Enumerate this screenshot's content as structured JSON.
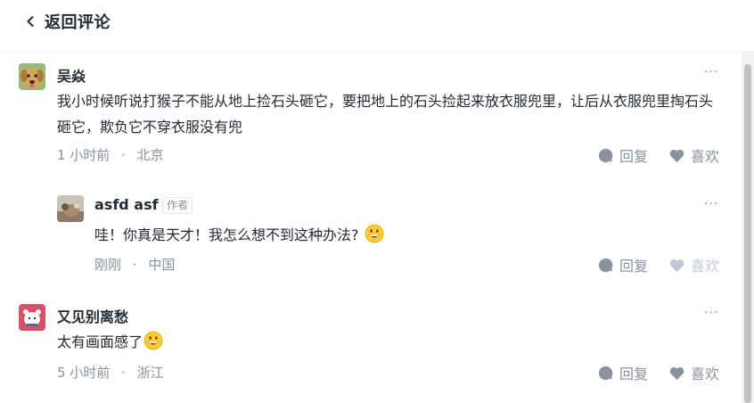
{
  "header": {
    "title": "返回评论"
  },
  "comments": [
    {
      "author": "吴焱",
      "text": "我小时候听说打猴子不能从地上捡石头砸它，要把地上的石头捡起来放衣服兜里，让后从衣服兜里掏石头砸它，欺负它不穿衣服没有兜",
      "time": "1 小时前",
      "location": "北京",
      "reply_label": "回复",
      "like_label": "喜欢"
    },
    {
      "author": "asfd asf",
      "badge": "作者",
      "text": "哇！你真是天才！我怎么想不到这种办法?",
      "time": "刚刚",
      "location": "中国",
      "reply_label": "回复",
      "like_label": "喜欢"
    },
    {
      "author": "又见别离愁",
      "text": "太有画面感了",
      "time": "5 小时前",
      "location": "浙江",
      "reply_label": "回复",
      "like_label": "喜欢"
    }
  ],
  "meta_separator": "·",
  "more_label": "···",
  "colors": {
    "text": "#252933",
    "secondary": "#8a919f",
    "divider": "#f2f3f5"
  }
}
